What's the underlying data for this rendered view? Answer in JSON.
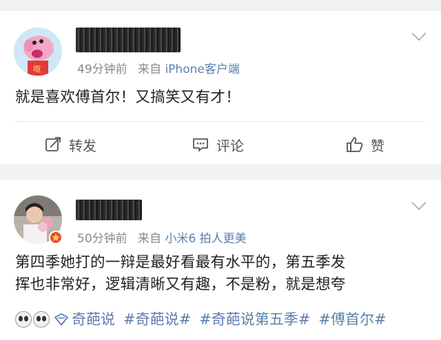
{
  "posts": [
    {
      "time": "49分钟前",
      "from_label": "来自",
      "source": "iPhone客户端",
      "content": "就是喜欢傅首尔！又搞笑又有才！",
      "avatar_text": "呕"
    },
    {
      "time": "50分钟前",
      "from_label": "来自",
      "source": "小米6 拍人更美",
      "content_line1": "第四季她打的一辩是最好看最有水平的，第五季发",
      "content_line2": "挥也非常好，逻辑清晰又有趣，不是粉，就是想夸",
      "topic": "奇葩说",
      "tags": [
        "#奇葩说#",
        "#奇葩说第五季#",
        "#傅首尔#"
      ]
    }
  ],
  "actions": {
    "repost": "转发",
    "comment": "评论",
    "like": "赞"
  },
  "colors": {
    "link": "#5b7faa",
    "meta": "#8a8a8a",
    "background": "#f2f2f2"
  },
  "icons": [
    "chevron-down-icon",
    "repost-icon",
    "comment-icon",
    "like-icon",
    "topic-icon",
    "emoji-icon"
  ]
}
